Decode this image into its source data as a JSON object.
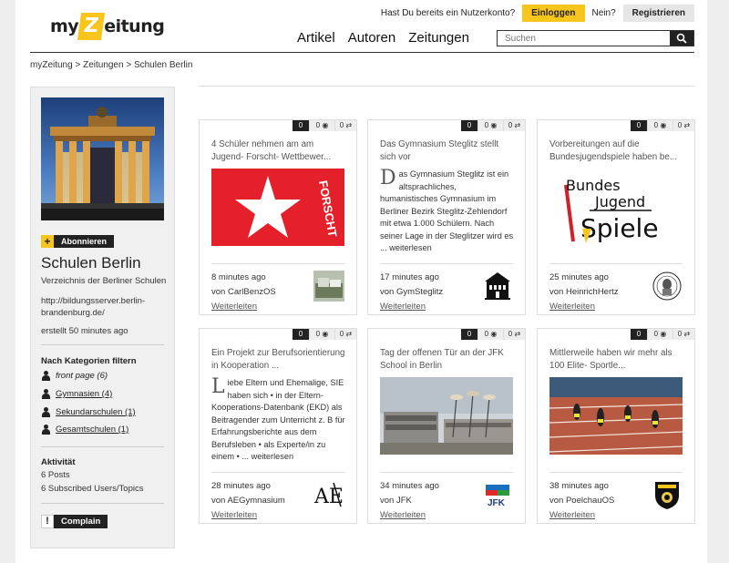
{
  "header": {
    "logo": {
      "prefix": "my",
      "z": "Z",
      "suffix": "eitung"
    },
    "account_question": "Hast Du bereits ein Nutzerkonto?",
    "login_label": "Einloggen",
    "no_label": "Nein?",
    "register_label": "Registrieren",
    "nav": [
      "Artikel",
      "Autoren",
      "Zeitungen"
    ],
    "search_placeholder": "Suchen"
  },
  "breadcrumb": "myZeitung > Zeitungen > Schulen Berlin",
  "sidebar": {
    "subscribe_label": "Abonnieren",
    "title": "Schulen Berlin",
    "subtitle": "Verzeichnis der Berliner Schulen",
    "url": "http://bildungsserver.berlin-brandenburg.de/",
    "created": "erstellt 50 minutes ago",
    "filter_heading": "Nach Kategorien filtern",
    "categories": [
      {
        "label": "front page (6)"
      },
      {
        "label": "Gymnasien (4)"
      },
      {
        "label": "Sekundarschulen (1)"
      },
      {
        "label": "Gesamtschulen (1)"
      }
    ],
    "activity_heading": "Aktivität",
    "posts": "6 Posts",
    "subscribed": "6 Subscribed Users/Topics",
    "complain_label": "Complain"
  },
  "cards": [
    {
      "comments": "0",
      "views": "0",
      "shares": "0",
      "title": "4 Schüler nehmen am am Jugend- Forscht- Wettbewer...",
      "body_cap": "",
      "body": "",
      "more": "",
      "time": "8 minutes ago",
      "by_prefix": "von",
      "author": "CarlBenzOS",
      "forward": "Weiterleiten"
    },
    {
      "comments": "0",
      "views": "0",
      "shares": "0",
      "title": "Das Gymnasium Steglitz stellt sich vor",
      "body_cap": "D",
      "body": "as Gymnasium Steglitz ist ein altsprachliches, humanistisches Gymnasium im Berliner Bezirk Steglitz-Zehlendorf mit etwa 1.000 Schülern. Nach seiner Lage in der Steglitzer wird es ...",
      "more": "weiterlesen",
      "time": "17 minutes ago",
      "by_prefix": "von",
      "author": "GymSteglitz",
      "forward": "Weiterleiten"
    },
    {
      "comments": "0",
      "views": "0",
      "shares": "0",
      "title": "Vorbereitungen auf die Bundesjugendspiele haben be...",
      "body_cap": "",
      "body": "",
      "more": "",
      "time": "25 minutes ago",
      "by_prefix": "von",
      "author": "HeinrichHertz",
      "forward": "Weiterleiten"
    },
    {
      "comments": "0",
      "views": "0",
      "shares": "0",
      "title": "Ein Projekt zur Berufsorientierung in Kooperation ...",
      "body_cap": "L",
      "body": "iebe Eltern und Ehemalige, SIE haben sich • in der Eltern-Kooperations-Datenbank (EKD) als Beitragender zum Unterricht z. B für Erfahrungsberichte aus dem Berufsleben • als Experte/in zu einem • ...",
      "more": "weiterlesen",
      "time": "28 minutes ago",
      "by_prefix": "von",
      "author": "AEGymnasium",
      "forward": "Weiterleiten"
    },
    {
      "comments": "0",
      "views": "0",
      "shares": "0",
      "title": "Tag der offenen Tür an der JFK School in Berlin",
      "body_cap": "",
      "body": "",
      "more": "",
      "time": "34 minutes ago",
      "by_prefix": "von",
      "author": "JFK",
      "forward": "Weiterleiten"
    },
    {
      "comments": "0",
      "views": "0",
      "shares": "0",
      "title": "Mittlerweile haben wir mehr als 100 Elite- Sportle...",
      "body_cap": "",
      "body": "",
      "more": "",
      "time": "38 minutes ago",
      "by_prefix": "von",
      "author": "PoelchauOS",
      "forward": "Weiterleiten"
    }
  ],
  "image_text": {
    "jugend_forscht": "FORSCHT",
    "bjs_line1": "Bundes",
    "bjs_line2": "Jugend",
    "bjs_line3": "Spiele",
    "ae_logo": "AE",
    "jfk_logo": "JFK"
  },
  "colors": {
    "accent": "#f7c51c",
    "dark": "#222222",
    "sidebar_bg": "#f0f0f0"
  }
}
